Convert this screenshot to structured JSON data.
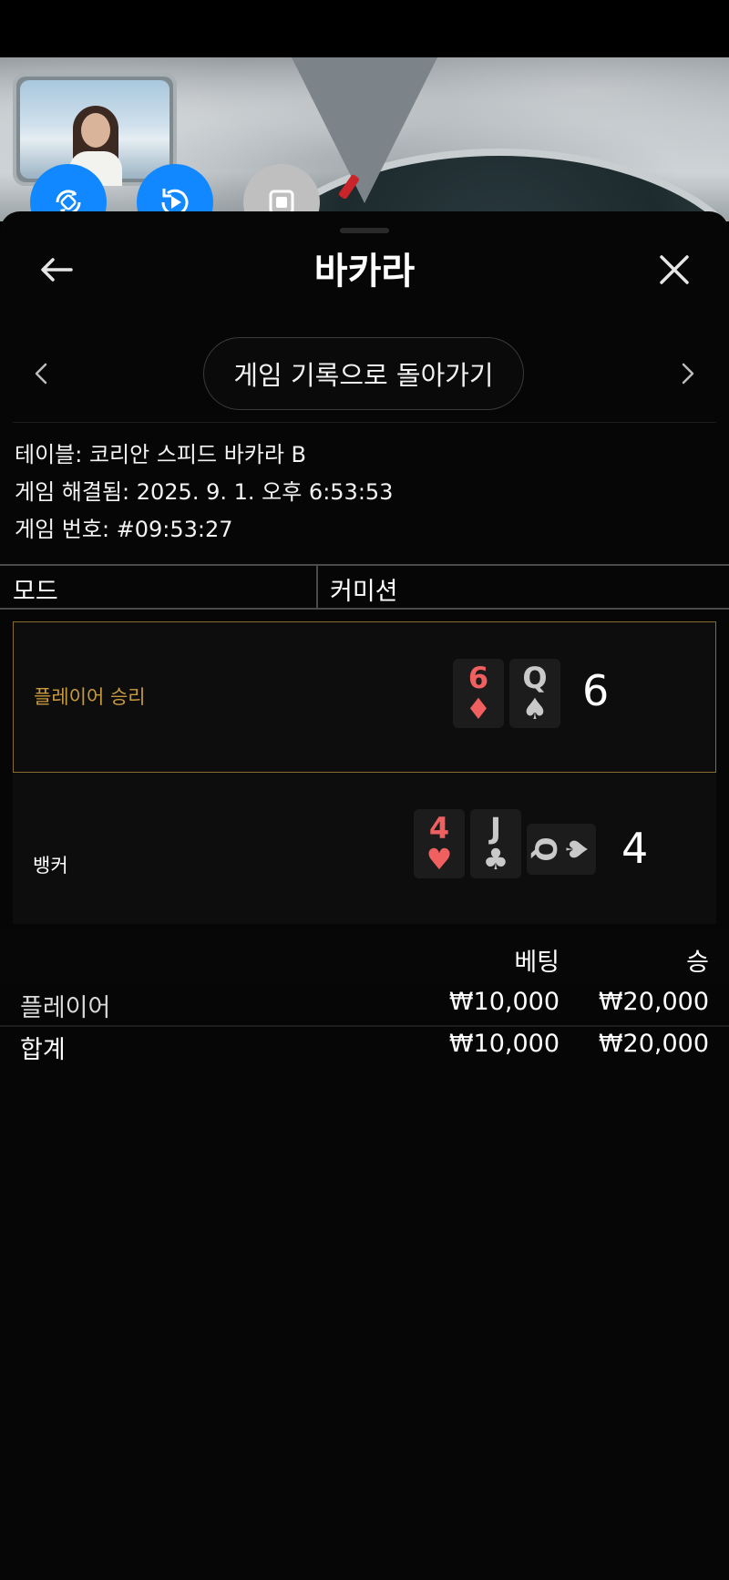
{
  "header": {
    "title": "바카라"
  },
  "nav": {
    "back_to_history": "게임 기록으로 돌아가기"
  },
  "info": {
    "table": "테이블: 코리안 스피드 바카라 B",
    "resolved": "게임 해결됨: 2025. 9. 1. 오후 6:53:53",
    "game_number": "게임 번호: #09:53:27"
  },
  "mode": {
    "label": "모드",
    "value": "커미션"
  },
  "player_hand": {
    "label": "플레이어 승리",
    "cards": [
      {
        "rank": "6",
        "suit": "♦",
        "color": "red"
      },
      {
        "rank": "Q",
        "suit": "♠",
        "color": "black"
      }
    ],
    "score": "6"
  },
  "banker_hand": {
    "label": "뱅커",
    "cards": [
      {
        "rank": "4",
        "suit": "♥",
        "color": "red"
      },
      {
        "rank": "J",
        "suit": "♣",
        "color": "black"
      },
      {
        "rank": "Q",
        "suit": "♠",
        "color": "black"
      }
    ],
    "score": "4"
  },
  "bets": {
    "headers": {
      "bet": "베팅",
      "win": "승"
    },
    "rows": [
      {
        "name": "플레이어",
        "bet": "₩10,000",
        "win": "₩20,000"
      },
      {
        "name": "합계",
        "bet": "₩10,000",
        "win": "₩20,000"
      }
    ]
  },
  "colors": {
    "accent_blue": "#1188ff",
    "winner_gold": "#c79a3e",
    "card_red": "#f06060"
  }
}
